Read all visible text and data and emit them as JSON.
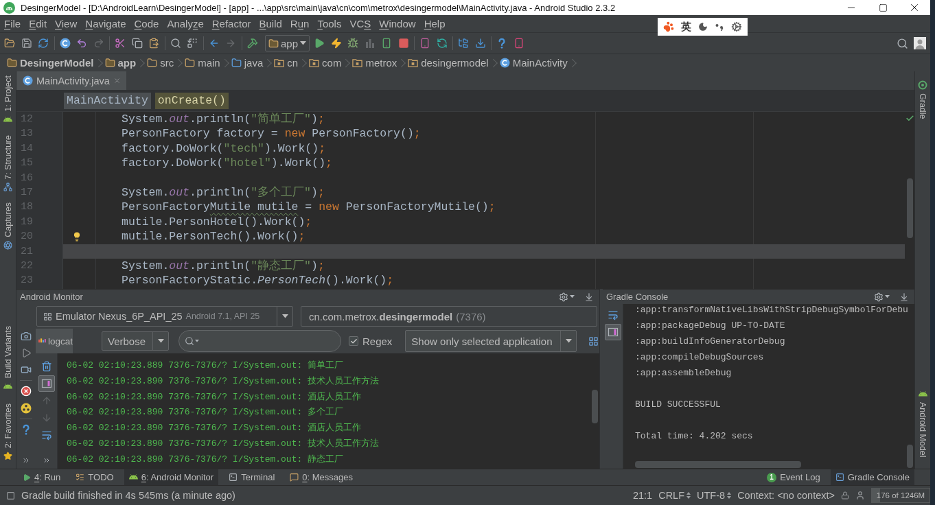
{
  "window": {
    "title": "DesingerModel - [D:\\AndroidLearn\\DesingerModel] - [app] - ...\\app\\src\\main\\java\\cn\\com\\metrox\\desingermodel\\MainActivity.java - Android Studio 2.3.2"
  },
  "menu": [
    {
      "access_key": "F",
      "label_after": "ile"
    },
    {
      "access_key": "E",
      "label_after": "dit"
    },
    {
      "access_key": "V",
      "label_after": "iew"
    },
    {
      "access_key": "N",
      "label_after": "avigate"
    },
    {
      "access_key": "C",
      "label_after": "ode"
    },
    {
      "label_before": "Analy",
      "access_key": "z",
      "label_after": "e"
    },
    {
      "access_key": "R",
      "label_after": "efactor"
    },
    {
      "access_key": "B",
      "label_after": "uild"
    },
    {
      "label_before": "R",
      "access_key": "u",
      "label_after": "n"
    },
    {
      "access_key": "T",
      "label_after": "ools"
    },
    {
      "label_before": "VC",
      "access_key": "S"
    },
    {
      "access_key": "W",
      "label_after": "indow"
    },
    {
      "access_key": "H",
      "label_after": "elp"
    }
  ],
  "ime_bar": {
    "mode": "英"
  },
  "toolbar": {
    "buttons": [
      {
        "disabled": false
      },
      {
        "disabled": false
      },
      {
        "disabled": false
      },
      {
        "disabled": false
      },
      {
        "disabled": false
      },
      {
        "disabled": true
      },
      {
        "disabled": false
      },
      {
        "disabled": false
      },
      {
        "disabled": false
      },
      {
        "disabled": false
      },
      {
        "disabled": false
      },
      {
        "disabled": false
      },
      {
        "disabled": true
      },
      {
        "disabled": false
      },
      {
        "disabled": false
      },
      {
        "disabled": false
      },
      {
        "disabled": false
      },
      {
        "disabled": true
      },
      {
        "disabled": false
      },
      {
        "disabled": false
      },
      {
        "disabled": false
      },
      {
        "disabled": false
      },
      {
        "disabled": false
      },
      {
        "disabled": false
      },
      {
        "disabled": false
      },
      {
        "disabled": false
      }
    ],
    "run_config": "app"
  },
  "nav_bar": [
    {
      "label": "DesingerModel",
      "kind": "module"
    },
    {
      "label": "app",
      "kind": "module"
    },
    {
      "label": "src",
      "kind": "folder"
    },
    {
      "label": "main",
      "kind": "folder"
    },
    {
      "label": "java",
      "kind": "source"
    },
    {
      "label": "cn",
      "kind": "package"
    },
    {
      "label": "com",
      "kind": "package"
    },
    {
      "label": "metrox",
      "kind": "package"
    },
    {
      "label": "desingermodel",
      "kind": "package"
    },
    {
      "label": "MainActivity",
      "kind": "class"
    }
  ],
  "left_tool_strip": {
    "top": [
      {
        "label": "1: Project"
      },
      {
        "label": "7: Structure"
      },
      {
        "label": "Captures"
      }
    ],
    "bottom": [
      {
        "label": "Build Variants"
      },
      {
        "label": "2: Favorites"
      }
    ]
  },
  "editor": {
    "tabs": [
      {
        "label": "MainActivity.java",
        "selected": true
      }
    ],
    "breadcrumbs": [
      {
        "label": "MainActivity",
        "selected": false
      },
      {
        "label": "onCreate()",
        "selected": true
      }
    ],
    "lines": [
      {
        "number": "12",
        "current": false,
        "bulb": false,
        "tokens": [
          {
            "text": "System.",
            "kind": "plain"
          },
          {
            "text": "out",
            "kind": "field"
          },
          {
            "text": ".println(",
            "kind": "plain"
          },
          {
            "text": "\"简单工厂\"",
            "kind": "string"
          },
          {
            "text": ")",
            "kind": "plain"
          },
          {
            "text": ";",
            "kind": "punct"
          }
        ]
      },
      {
        "number": "13",
        "current": false,
        "bulb": false,
        "tokens": [
          {
            "text": "PersonFactory factory = ",
            "kind": "plain"
          },
          {
            "text": "new",
            "kind": "keyword"
          },
          {
            "text": " PersonFactory()",
            "kind": "plain"
          },
          {
            "text": ";",
            "kind": "punct"
          }
        ]
      },
      {
        "number": "14",
        "current": false,
        "bulb": false,
        "tokens": [
          {
            "text": "factory.DoWork(",
            "kind": "plain"
          },
          {
            "text": "\"tech\"",
            "kind": "string"
          },
          {
            "text": ").Work()",
            "kind": "plain"
          },
          {
            "text": ";",
            "kind": "punct"
          }
        ]
      },
      {
        "number": "15",
        "current": false,
        "bulb": false,
        "tokens": [
          {
            "text": "factory.DoWork(",
            "kind": "plain"
          },
          {
            "text": "\"hotel\"",
            "kind": "string"
          },
          {
            "text": ").Work()",
            "kind": "plain"
          },
          {
            "text": ";",
            "kind": "punct"
          }
        ]
      },
      {
        "number": "16",
        "current": false,
        "bulb": false
      },
      {
        "number": "17",
        "current": false,
        "bulb": false,
        "tokens": [
          {
            "text": "System.",
            "kind": "plain"
          },
          {
            "text": "out",
            "kind": "field"
          },
          {
            "text": ".println(",
            "kind": "plain"
          },
          {
            "text": "\"多个工厂\"",
            "kind": "string"
          },
          {
            "text": ")",
            "kind": "plain"
          },
          {
            "text": ";",
            "kind": "punct"
          }
        ]
      },
      {
        "number": "18",
        "current": false,
        "bulb": false,
        "tokens": [
          {
            "text": "PersonFactory",
            "kind": "plain"
          },
          {
            "text": "Mutile mutile",
            "kind": "typo"
          },
          {
            "text": " = ",
            "kind": "plain"
          },
          {
            "text": "new",
            "kind": "keyword"
          },
          {
            "text": " PersonFactoryMutile()",
            "kind": "plain"
          },
          {
            "text": ";",
            "kind": "punct"
          }
        ]
      },
      {
        "number": "19",
        "current": false,
        "bulb": false,
        "tokens": [
          {
            "text": "mutile.PersonHotel().Work()",
            "kind": "plain"
          },
          {
            "text": ";",
            "kind": "punct"
          }
        ]
      },
      {
        "number": "20",
        "current": false,
        "bulb": true,
        "tokens": [
          {
            "text": "mutile.PersonTech().Work()",
            "kind": "plain"
          },
          {
            "text": ";",
            "kind": "punct"
          }
        ]
      },
      {
        "number": "21",
        "current": true,
        "bulb": false
      },
      {
        "number": "22",
        "current": false,
        "bulb": false,
        "tokens": [
          {
            "text": "System.",
            "kind": "plain"
          },
          {
            "text": "out",
            "kind": "field"
          },
          {
            "text": ".println(",
            "kind": "plain"
          },
          {
            "text": "\"静态工厂\"",
            "kind": "string"
          },
          {
            "text": ")",
            "kind": "plain"
          },
          {
            "text": ";",
            "kind": "punct"
          }
        ]
      },
      {
        "number": "23",
        "current": false,
        "bulb": false,
        "tokens": [
          {
            "text": "PersonFactoryStatic.",
            "kind": "plain"
          },
          {
            "text": "PersonTech",
            "kind": "static"
          },
          {
            "text": "().Work()",
            "kind": "plain"
          },
          {
            "text": ";",
            "kind": "punct"
          }
        ]
      }
    ]
  },
  "right_tool_strip": {
    "top": [
      {
        "label": "Gradle"
      }
    ],
    "bottom": [
      {
        "label": "Android Model"
      }
    ]
  },
  "android_monitor": {
    "title": "Android Monitor",
    "device": {
      "name": "Emulator Nexus_6P_API_25",
      "detail": "Android 7.1, API 25"
    },
    "process": {
      "name": "cn.com.metrox.**desingermodel**",
      "pid": "(7376)"
    },
    "tabs": [
      {
        "label": "logcat",
        "selected": true
      }
    ],
    "log_level": "Verbose",
    "regex": {
      "label": "Regex",
      "checked": true
    },
    "filter": "Show only selected application",
    "log_tools": [
      {
        "selected": false,
        "disabled": false
      },
      {
        "selected": true,
        "disabled": false
      },
      {
        "selected": false,
        "disabled": true
      },
      {
        "selected": false,
        "disabled": true
      },
      {
        "selected": false,
        "disabled": false
      }
    ],
    "log_lines": [
      "06-02 02:10:23.889 7376-7376/? I/System.out: 简单工厂",
      "06-02 02:10:23.890 7376-7376/? I/System.out: 技术人员工作方法",
      "06-02 02:10:23.890 7376-7376/? I/System.out: 酒店人员工作",
      "06-02 02:10:23.890 7376-7376/? I/System.out: 多个工厂",
      "06-02 02:10:23.890 7376-7376/? I/System.out: 酒店人员工作",
      "06-02 02:10:23.890 7376-7376/? I/System.out: 技术人员工作方法",
      "06-02 02:10:23.890 7376-7376/? I/System.out: 静态工厂"
    ]
  },
  "gradle_console": {
    "title": "Gradle Console",
    "tools": [
      {
        "selected": false
      },
      {
        "selected": true
      }
    ],
    "lines": [
      {
        "text": ":app:transformNativeLibsWithStripDebugSymbolForDebu",
        "kind": "task"
      },
      {
        "text": ":app:packageDebug UP-TO-DATE",
        "kind": "task"
      },
      {
        "text": ":app:buildInfoGeneratorDebug",
        "kind": "task"
      },
      {
        "text": ":app:compileDebugSources",
        "kind": "task"
      },
      {
        "text": ":app:assembleDebug",
        "kind": "task"
      },
      {
        "text": "BUILD SUCCESSFUL",
        "kind": "result"
      },
      {
        "text": "Total time: 4.202 secs",
        "kind": "result"
      }
    ]
  },
  "bottom_tool_bar": {
    "left": [
      {
        "access_key": "4",
        "label_after": ": Run",
        "selected": false
      },
      {
        "label_before": "TODO",
        "selected": false
      },
      {
        "access_key": "6",
        "label_after": ": Android Monitor",
        "selected": true
      },
      {
        "label_before": "Terminal",
        "selected": false
      },
      {
        "access_key": "0",
        "label_after": ": Messages",
        "selected": false
      }
    ],
    "right": [
      {
        "label_before": "Event Log",
        "badge": "1",
        "selected": false
      },
      {
        "label_before": "Gradle Console",
        "selected": true
      }
    ]
  },
  "status_bar": {
    "message": "Gradle build finished in 4s 545ms (a minute ago)",
    "position": "21:1",
    "line_separator": "CRLF",
    "encoding": "UTF-8",
    "context": "Context: <no context>",
    "memory": {
      "text": "176 of 1246M",
      "level": 0.14
    }
  }
}
